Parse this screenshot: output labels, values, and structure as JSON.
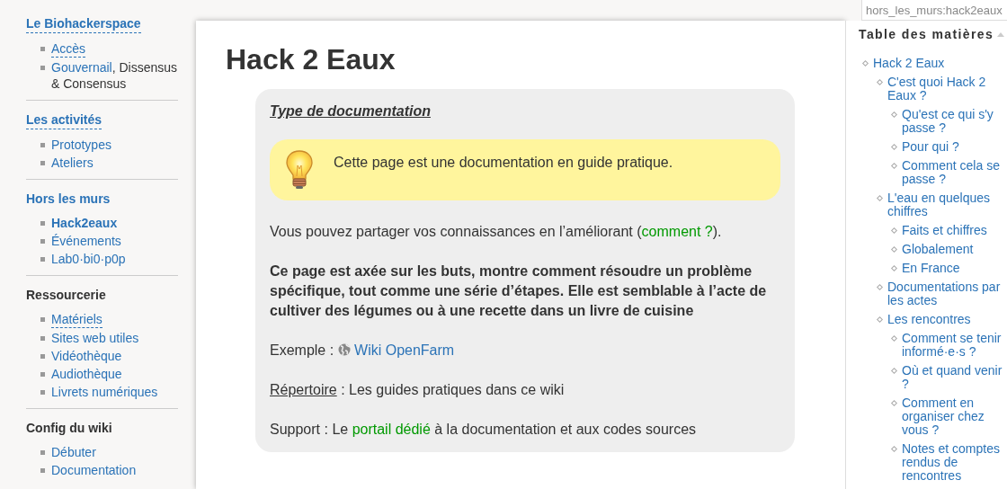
{
  "breadcrumb": "hors_les_murs:hack2eaux",
  "sidebar": {
    "sections": [
      {
        "title": "Le Biohackerspace",
        "kind": "missing",
        "items": [
          {
            "parts": [
              {
                "kind": "missing",
                "text": "Accès"
              }
            ]
          },
          {
            "parts": [
              {
                "kind": "link",
                "text": "Gouvernail"
              },
              {
                "kind": "text",
                "text": ", Dissensus & Consensus"
              }
            ]
          }
        ]
      },
      {
        "title": "Les activités",
        "kind": "missing",
        "items": [
          {
            "parts": [
              {
                "kind": "link",
                "text": "Prototypes"
              }
            ]
          },
          {
            "parts": [
              {
                "kind": "link",
                "text": "Ateliers"
              }
            ]
          }
        ]
      },
      {
        "title": "Hors les murs",
        "kind": "link",
        "items": [
          {
            "parts": [
              {
                "kind": "current",
                "text": "Hack2eaux"
              }
            ]
          },
          {
            "parts": [
              {
                "kind": "link",
                "text": "Événements"
              }
            ]
          },
          {
            "parts": [
              {
                "kind": "link",
                "text": "Lab0·bi0·p0p"
              }
            ]
          }
        ]
      },
      {
        "title": "Ressourcerie",
        "kind": "text",
        "items": [
          {
            "parts": [
              {
                "kind": "missing",
                "text": "Matériels"
              }
            ]
          },
          {
            "parts": [
              {
                "kind": "link",
                "text": "Sites web utiles"
              }
            ]
          },
          {
            "parts": [
              {
                "kind": "link",
                "text": "Vidéothèque"
              }
            ]
          },
          {
            "parts": [
              {
                "kind": "link",
                "text": "Audiothèque"
              }
            ]
          },
          {
            "parts": [
              {
                "kind": "link",
                "text": "Livrets numériques"
              }
            ]
          }
        ]
      },
      {
        "title": "Config du wiki",
        "kind": "text",
        "items": [
          {
            "parts": [
              {
                "kind": "link",
                "text": "Débuter"
              }
            ]
          },
          {
            "parts": [
              {
                "kind": "link",
                "text": "Documentation"
              }
            ]
          }
        ]
      }
    ]
  },
  "page": {
    "title": "Hack 2 Eaux",
    "box_heading": "Type de documentation",
    "note": "Cette page est une documentation en guide pratique.",
    "paragraphs": [
      {
        "kind": "normal",
        "parts": [
          {
            "kind": "text",
            "text": "Vous pouvez partager vos connaissances en l’améliorant ("
          },
          {
            "kind": "link",
            "text": "comment ?"
          },
          {
            "kind": "text",
            "text": ")."
          }
        ]
      },
      {
        "kind": "bold",
        "parts": [
          {
            "kind": "text",
            "text": "Ce page est axée sur les buts, montre comment résoudre un problème spécifique, tout comme une série d’étapes. Elle est semblable à l’acte de cultiver des légumes ou à une recette dans un livre de cuisine"
          }
        ]
      },
      {
        "kind": "normal",
        "parts": [
          {
            "kind": "text",
            "text": "Exemple : "
          },
          {
            "kind": "external",
            "text": "Wiki OpenFarm"
          }
        ]
      },
      {
        "kind": "normal",
        "parts": [
          {
            "kind": "underline",
            "text": "Répertoire"
          },
          {
            "kind": "text",
            "text": " : Les guides pratiques dans ce wiki"
          }
        ]
      },
      {
        "kind": "normal",
        "parts": [
          {
            "kind": "text",
            "text": "Support : Le "
          },
          {
            "kind": "link",
            "text": "portail dédié"
          },
          {
            "kind": "text",
            "text": " à la documentation et aux codes sources"
          }
        ]
      }
    ]
  },
  "toc": {
    "title": "Table des matières",
    "items": [
      {
        "text": "Hack 2 Eaux",
        "children": [
          {
            "text": "C'est quoi Hack 2 Eaux ?",
            "children": [
              {
                "text": "Qu'est ce qui s'y passe ?"
              },
              {
                "text": "Pour qui ?"
              },
              {
                "text": "Comment cela se passe ?"
              }
            ]
          },
          {
            "text": "L'eau en quelques chiffres",
            "children": [
              {
                "text": "Faits et chiffres"
              },
              {
                "text": "Globalement"
              },
              {
                "text": "En France"
              }
            ]
          },
          {
            "text": "Documentations par les actes"
          },
          {
            "text": "Les rencontres",
            "children": [
              {
                "text": "Comment se tenir informé·e·s ?"
              },
              {
                "text": "Où et quand venir ?"
              },
              {
                "text": "Comment en organiser chez vous ?"
              },
              {
                "text": "Notes et comptes rendus de rencontres"
              }
            ]
          }
        ]
      }
    ]
  }
}
